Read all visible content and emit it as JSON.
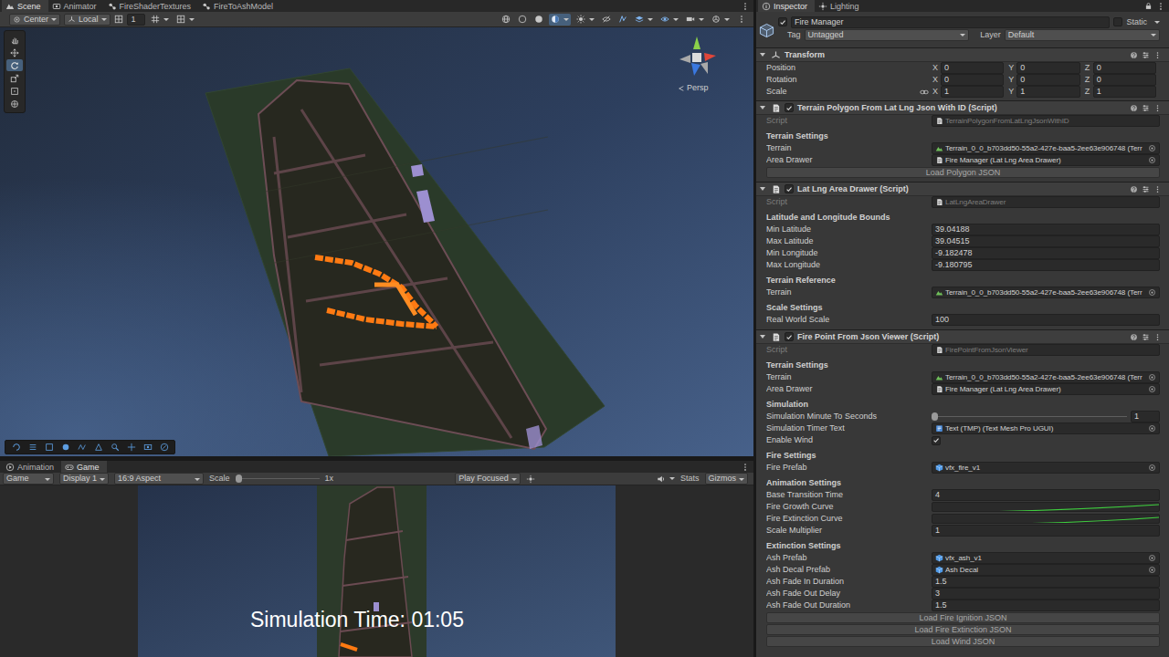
{
  "scene_window": {
    "tabs": [
      {
        "label": "Scene",
        "selected": true
      },
      {
        "label": "Animator",
        "selected": false
      },
      {
        "label": "FireShaderTextures",
        "selected": false
      },
      {
        "label": "FireToAshModel",
        "selected": false
      }
    ],
    "toolbar": {
      "pivot": "Center",
      "space": "Local",
      "snap_increment": "1"
    },
    "tools": [
      {
        "kind": "hand",
        "selected": false
      },
      {
        "kind": "move",
        "selected": false
      },
      {
        "kind": "rotate",
        "selected": true
      },
      {
        "kind": "scale",
        "selected": false
      },
      {
        "kind": "rect",
        "selected": false
      },
      {
        "kind": "transform",
        "selected": false
      }
    ],
    "projection": "Persp"
  },
  "game_window": {
    "tabs": [
      {
        "label": "Animation",
        "selected": false
      },
      {
        "label": "Game",
        "selected": true
      }
    ],
    "toolbar": {
      "mode": "Game",
      "display": "Display 1",
      "aspect": "16:9 Aspect",
      "scale_label": "Scale",
      "scale_level": 0,
      "scale_value": "1x",
      "play_mode": "Play Focused",
      "stats": "Stats",
      "gizmos": "Gizmos"
    },
    "timer": "Simulation Time: 01:05"
  },
  "inspector": {
    "tabs": [
      {
        "label": "Inspector",
        "selected": true
      },
      {
        "label": "Lighting",
        "selected": false
      }
    ],
    "object": {
      "name": "Fire Manager",
      "active": true,
      "static_label": "Static",
      "static": false,
      "tag_label": "Tag",
      "tag": "Untagged",
      "layer_label": "Layer",
      "layer": "Default"
    },
    "components": [
      {
        "kind": "transform",
        "title": "Transform",
        "expanded": true,
        "rows": [
          {
            "label": "Position",
            "linked": false,
            "values": [
              {
                "axis": "X",
                "value": "0"
              },
              {
                "axis": "Y",
                "value": "0"
              },
              {
                "axis": "Z",
                "value": "0"
              }
            ]
          },
          {
            "label": "Rotation",
            "linked": false,
            "values": [
              {
                "axis": "X",
                "value": "0"
              },
              {
                "axis": "Y",
                "value": "0"
              },
              {
                "axis": "Z",
                "value": "0"
              }
            ]
          },
          {
            "label": "Scale",
            "linked": true,
            "values": [
              {
                "axis": "X",
                "value": "1"
              },
              {
                "axis": "Y",
                "value": "1"
              },
              {
                "axis": "Z",
                "value": "1"
              }
            ]
          }
        ]
      },
      {
        "kind": "script",
        "title": "Terrain Polygon From Lat Lng Json With ID (Script)",
        "expanded": true,
        "enabled": true,
        "script": {
          "label": "Script",
          "value": "TerrainPolygonFromLatLngJsonWithID",
          "disabled": true
        },
        "sections": [
          {
            "heading": "Terrain Settings",
            "fields": [
              {
                "kind": "object",
                "label": "Terrain",
                "value": "Terrain_0_0_b703dd50-55a2-427e-baa5-2ee63e906748 (Terr"
              },
              {
                "kind": "object",
                "label": "Area Drawer",
                "value": "Fire Manager (Lat Lng Area Drawer)"
              },
              {
                "kind": "button",
                "label": "Load Polygon JSON"
              }
            ]
          }
        ]
      },
      {
        "kind": "script",
        "title": "Lat Lng Area Drawer (Script)",
        "expanded": true,
        "enabled": true,
        "script": {
          "label": "Script",
          "value": "LatLngAreaDrawer",
          "disabled": true
        },
        "sections": [
          {
            "heading": "Latitude and Longitude Bounds",
            "fields": [
              {
                "kind": "float",
                "label": "Min Latitude",
                "value": "39.04188"
              },
              {
                "kind": "float",
                "label": "Max Latitude",
                "value": "39.04515"
              },
              {
                "kind": "float",
                "label": "Min Longitude",
                "value": "-9.182478"
              },
              {
                "kind": "float",
                "label": "Max Longitude",
                "value": "-9.180795"
              }
            ]
          },
          {
            "heading": "Terrain Reference",
            "fields": [
              {
                "kind": "object",
                "label": "Terrain",
                "value": "Terrain_0_0_b703dd50-55a2-427e-baa5-2ee63e906748 (Terr"
              }
            ]
          },
          {
            "heading": "Scale Settings",
            "fields": [
              {
                "kind": "float",
                "label": "Real World Scale",
                "value": "100"
              }
            ]
          }
        ]
      },
      {
        "kind": "script",
        "title": "Fire Point From Json Viewer (Script)",
        "expanded": true,
        "enabled": true,
        "script": {
          "label": "Script",
          "value": "FirePointFromJsonViewer",
          "disabled": true
        },
        "sections": [
          {
            "heading": "Terrain Settings",
            "fields": [
              {
                "kind": "object",
                "label": "Terrain",
                "value": "Terrain_0_0_b703dd50-55a2-427e-baa5-2ee63e906748 (Terr"
              },
              {
                "kind": "object",
                "label": "Area Drawer",
                "value": "Fire Manager (Lat Lng Area Drawer)"
              }
            ]
          },
          {
            "heading": "Simulation",
            "fields": [
              {
                "kind": "slider",
                "label": "Simulation Minute To Seconds",
                "level": 0,
                "value": "1"
              },
              {
                "kind": "object",
                "label": "Simulation Timer Text",
                "value": "Text (TMP) (Text Mesh Pro UGUI)"
              },
              {
                "kind": "checkbox",
                "label": "Enable Wind",
                "checked": true
              }
            ]
          },
          {
            "heading": "Fire Settings",
            "fields": [
              {
                "kind": "object",
                "label": "Fire Prefab",
                "value": "vfx_fire_v1"
              }
            ]
          },
          {
            "heading": "Animation Settings",
            "fields": [
              {
                "kind": "float",
                "label": "Base Transition Time",
                "value": "4"
              },
              {
                "kind": "curve",
                "label": "Fire Growth Curve"
              },
              {
                "kind": "curve",
                "label": "Fire Extinction Curve"
              },
              {
                "kind": "float",
                "label": "Scale Multiplier",
                "value": "1"
              }
            ]
          },
          {
            "heading": "Extinction Settings",
            "fields": [
              {
                "kind": "object",
                "label": "Ash Prefab",
                "value": "vfx_ash_v1"
              },
              {
                "kind": "object",
                "label": "Ash Decal Prefab",
                "value": "Ash Decal"
              },
              {
                "kind": "float",
                "label": "Ash Fade In Duration",
                "value": "1.5"
              },
              {
                "kind": "float",
                "label": "Ash Fade Out Delay",
                "value": "3"
              },
              {
                "kind": "float",
                "label": "Ash Fade Out Duration",
                "value": "1.5"
              },
              {
                "kind": "button",
                "label": "Load Fire Ignition JSON"
              },
              {
                "kind": "button",
                "label": "Load Fire Extinction JSON"
              },
              {
                "kind": "button",
                "label": "Load Wind JSON"
              }
            ]
          }
        ]
      }
    ]
  }
}
